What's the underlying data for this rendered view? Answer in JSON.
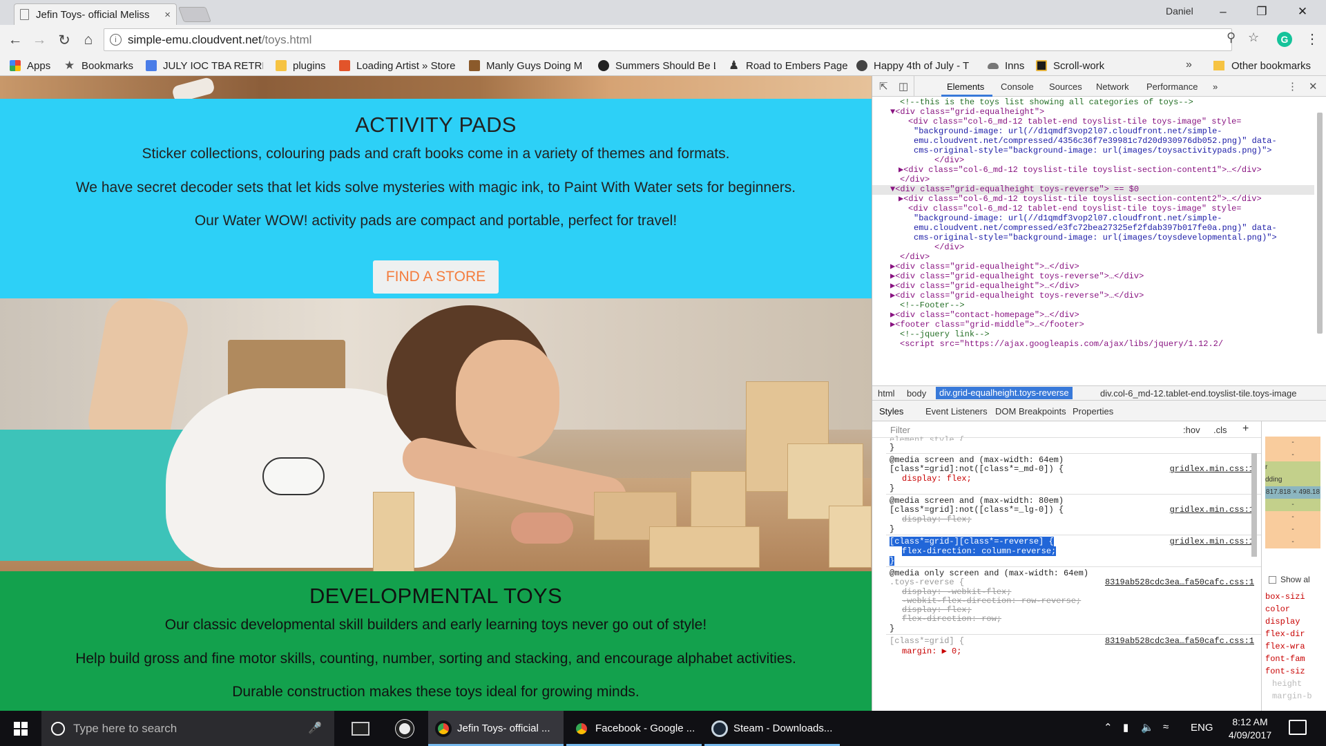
{
  "browser": {
    "tab_title": "Jefin Toys- official Meliss",
    "tab_close": "×",
    "profile_name": "Daniel",
    "url_host": "simple-emu.cloudvent.net",
    "url_path": "/toys.html",
    "bookmarks": [
      {
        "label": "Apps",
        "icon": "apps-grid-icon",
        "color": "#4285f4"
      },
      {
        "label": "Bookmarks",
        "icon": "star-icon",
        "color": "#555555"
      },
      {
        "label": "JULY IOC TBA RETREA",
        "icon": "docs-icon",
        "color": "#4a7de8"
      },
      {
        "label": "plugins",
        "icon": "folder-icon",
        "color": "#f6c342"
      },
      {
        "label": "Loading Artist » Store",
        "icon": "loading-artist-icon",
        "color": "#e2542a"
      },
      {
        "label": "Manly Guys Doing M",
        "icon": "comic-icon",
        "color": "#8b5a2b"
      },
      {
        "label": "Summers Should Be L",
        "icon": "disc-icon",
        "color": "#222222"
      },
      {
        "label": "Road to Embers Page",
        "icon": "chess-piece-icon",
        "color": "#333333"
      },
      {
        "label": "Happy 4th of July - T",
        "icon": "face-icon",
        "color": "#444444"
      },
      {
        "label": "Inns",
        "icon": "cloud-icon",
        "color": "#666666"
      },
      {
        "label": "Scroll-work",
        "icon": "scroll-icon",
        "color": "#1b1b1b"
      }
    ],
    "bookmarks_more": "»",
    "other_bookmarks": "Other bookmarks"
  },
  "page": {
    "sections": [
      {
        "title": "ACTIVITY PADS",
        "paragraphs": [
          "Sticker collections, colouring pads and craft books come in a variety of themes and formats.",
          "We have secret decoder sets that let kids solve mysteries with magic ink, to Paint With Water sets for beginners.",
          "Our Water WOW! activity pads are compact and portable, perfect for travel!"
        ],
        "button": "FIND A STORE",
        "bg": "#2dd0f7"
      },
      {
        "title": "DEVELOPMENTAL TOYS",
        "paragraphs": [
          "Our classic developmental skill builders and early learning toys never go out of style!",
          "Help build gross and fine motor skills, counting, number, sorting and stacking, and encourage alphabet activities.",
          "Durable construction makes these toys ideal for growing minds."
        ],
        "bg": "#13a14d"
      }
    ],
    "button_text_color": "#f47c3c"
  },
  "devtools": {
    "tabs": [
      "Elements",
      "Console",
      "Sources",
      "Network",
      "Performance"
    ],
    "active_tab": "Elements",
    "more": "»",
    "dom_lines": [
      "<!--this is the toys list showing all categories of toys-->",
      "▼<div class=\"grid-equalheight\">",
      "<div class=\"col-6_md-12 tablet-end toyslist-tile toys-image\" style=",
      "\"background-image: url(//d1qmdf3vop2l07.cloudfront.net/simple-",
      "emu.cloudvent.net/compressed/4356c36f7e39981c7d20d930976db052.png)\" data-",
      "cms-original-style=\"background-image: url(images/toysactivitypads.png)\">",
      "</div>",
      "▶<div class=\"col-6_md-12 toyslist-tile toyslist-section-content1\">…</div>",
      "</div>",
      "▼<div class=\"grid-equalheight toys-reverse\"> == $0",
      "▶<div class=\"col-6_md-12 toyslist-tile toyslist-section-content2\">…</div>",
      "<div class=\"col-6_md-12 tablet-end toyslist-tile toys-image\" style=",
      "\"background-image: url(//d1qmdf3vop2l07.cloudfront.net/simple-",
      "emu.cloudvent.net/compressed/e3fc72bea27325ef2fdab397b017fe0a.png)\" data-",
      "cms-original-style=\"background-image: url(images/toysdevelopmental.png)\">",
      "</div>",
      "</div>",
      "▶<div class=\"grid-equalheight\">…</div>",
      "▶<div class=\"grid-equalheight toys-reverse\">…</div>",
      "▶<div class=\"grid-equalheight\">…</div>",
      "▶<div class=\"grid-equalheight toys-reverse\">…</div>",
      "<!--Footer-->",
      "▶<div class=\"contact-homepage\">…</div>",
      "▶<footer class=\"grid-middle\">…</footer>",
      "<!--jquery link-->",
      "<script src=\"https://ajax.googleapis.com/ajax/libs/jquery/1.12.2/"
    ],
    "breadcrumbs": [
      "html",
      "body",
      "div.grid-equalheight.toys-reverse",
      "div.col-6_md-12.tablet-end.toyslist-tile.toys-image"
    ],
    "subtabs": [
      "Styles",
      "Event Listeners",
      "DOM Breakpoints",
      "Properties"
    ],
    "filter_placeholder": "Filter",
    "hov": ":hov",
    "cls": ".cls",
    "plus": "+",
    "style_lines": [
      "element.style {",
      "}",
      "@media screen and (max-width: 64em)",
      "[class*=grid]:not([class*=_md-0]) {",
      "display: flex;",
      "}",
      "@media screen and (max-width: 80em)",
      "[class*=grid]:not([class*=_lg-0]) {",
      "display: flex;",
      "}",
      "[class*=grid-][class*=-reverse] {",
      "flex-direction: column-reverse;",
      "}",
      "@media only screen and (max-width: 64em)",
      ".toys-reverse {",
      "display: -webkit-flex;",
      "-webkit-flex-direction: row-reverse;",
      "display: flex;",
      "flex-direction: row;",
      "}",
      "[class*=grid] {",
      "margin: ▶ 0;"
    ],
    "sources": [
      "gridlex.min.css:1",
      "gridlex.min.css:1",
      "gridlex.min.css:1",
      "8319ab528cdc3ea…fa50cafc.css:1",
      "8319ab528cdc3ea…fa50cafc.css:1"
    ],
    "box_labels": [
      "-",
      "-",
      "r",
      "dding",
      "-",
      "817.818 × 498.18",
      "-",
      "-",
      "-"
    ],
    "show_all": "Show al",
    "computed_props": [
      "box-sizi",
      "color",
      "display",
      "flex-dir",
      "flex-wra",
      "font-fam",
      "font-siz",
      "height",
      "margin-b"
    ]
  },
  "taskbar": {
    "search_placeholder": "Type here to search",
    "apps": [
      {
        "label": "Jefin Toys- official ...",
        "active": true,
        "color": "#ea4335"
      },
      {
        "label": "Facebook - Google ...",
        "active": false,
        "color": "#ea4335"
      },
      {
        "label": "Steam - Downloads...",
        "active": false,
        "color": "#1b2838"
      }
    ],
    "language": "ENG",
    "time": "8:12 AM",
    "date": "4/09/2017"
  }
}
